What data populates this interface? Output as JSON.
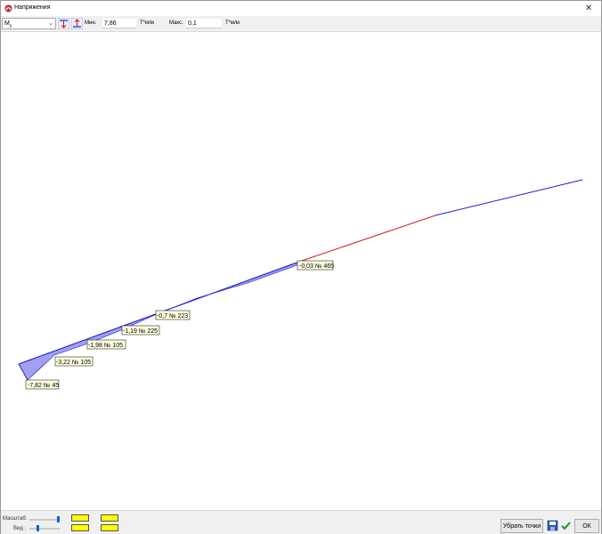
{
  "window": {
    "title": "Напряжения",
    "close_label": "✕"
  },
  "toolbar": {
    "component": "M",
    "component_sub": "y",
    "min_label": "Мин.",
    "min_value": "7,86",
    "min_unit": "Т*м/м",
    "max_label": "Макс.",
    "max_value": "0,1",
    "max_unit": "Т*м/м"
  },
  "labels": [
    {
      "text": "-0,03 № 465"
    },
    {
      "text": "-0,7 № 223"
    },
    {
      "text": "-1,19 № 225"
    },
    {
      "text": "-1,98 № 105"
    },
    {
      "text": "-3,22 № 105"
    },
    {
      "text": "-7,82 № 45"
    }
  ],
  "footer": {
    "scale_label": "Масштаб:",
    "view_label": "Вид :",
    "clear_points_button": "Убрать точки",
    "ok_button": "ОК"
  },
  "colors": {
    "negative_line": "#1a1ad0",
    "positive_line": "#d01a1a",
    "label_bg": "#ffffe0",
    "swatch": "#ffff00"
  },
  "icons": [
    "app-icon",
    "save-icon",
    "check-icon",
    "close-icon"
  ]
}
